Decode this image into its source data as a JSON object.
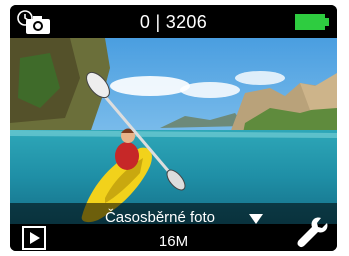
{
  "status": {
    "counter_text": "0 | 3206",
    "battery_color": "#2ecc40"
  },
  "mode": {
    "label": "Časosběrné foto"
  },
  "footer": {
    "resolution": "16M"
  },
  "icons": {
    "mode": "timelapse-camera-icon",
    "playback": "play-icon",
    "settings": "wrench-icon",
    "dropdown": "chevron-down-icon",
    "battery": "battery-icon"
  }
}
